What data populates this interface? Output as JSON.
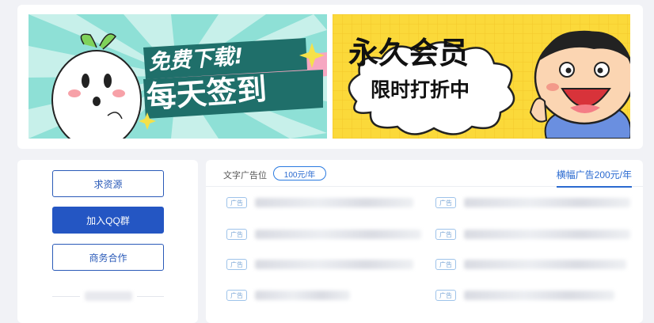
{
  "banners": {
    "left": {
      "line1": "免费下载!",
      "line2": "每天签到"
    },
    "right": {
      "line1": "永久会员",
      "line2": "限时打折中"
    }
  },
  "sidebar": {
    "buttons": [
      {
        "label": "求资源"
      },
      {
        "label": "加入QQ群"
      },
      {
        "label": "商务合作"
      }
    ]
  },
  "ads": {
    "title": "文字广告位",
    "price": "100元/年",
    "banner_link": "横幅广告200元/年",
    "tag_label": "广告",
    "rows_count": 8
  },
  "colors": {
    "accent": "#2456c3",
    "banner_left_bg": "#8ee0d6",
    "banner_right_bg": "#fbd93a",
    "page_bg": "#f1f2f6"
  }
}
